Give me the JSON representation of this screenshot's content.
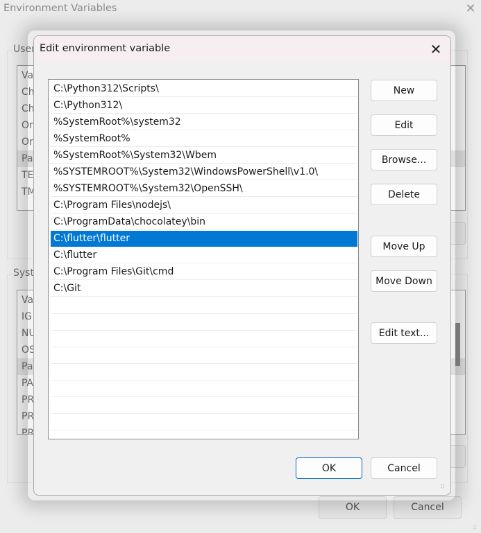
{
  "background_window": {
    "title": "Environment Variables",
    "close_icon": "close-icon",
    "user_group": {
      "label": "User",
      "rows": [
        "Va",
        "Ch",
        "Ch",
        "Or",
        "Or",
        "Pa",
        "TE",
        "TM"
      ],
      "selected_index": 5
    },
    "system_group": {
      "label": "Syste",
      "rows": [
        "Va",
        "IG",
        "NU",
        "OS",
        "Pa",
        "PA",
        "PR",
        "PR",
        "PR"
      ],
      "selected_index": 4
    },
    "buttons": {
      "ok": "OK",
      "cancel": "Cancel"
    }
  },
  "dialog": {
    "title": "Edit environment variable",
    "close_icon": "close-icon",
    "paths": [
      "C:\\Python312\\Scripts\\",
      "C:\\Python312\\",
      "%SystemRoot%\\system32",
      "%SystemRoot%",
      "%SystemRoot%\\System32\\Wbem",
      "%SYSTEMROOT%\\System32\\WindowsPowerShell\\v1.0\\",
      "%SYSTEMROOT%\\System32\\OpenSSH\\",
      "C:\\Program Files\\nodejs\\",
      "C:\\ProgramData\\chocolatey\\bin",
      "C:\\flutter\\flutter",
      "C:\\flutter",
      "C:\\Program Files\\Git\\cmd",
      "C:\\Git"
    ],
    "selected_index": 9,
    "buttons": {
      "new": "New",
      "edit": "Edit",
      "browse": "Browse...",
      "delete": "Delete",
      "move_up": "Move Up",
      "move_down": "Move Down",
      "edit_text": "Edit text...",
      "ok": "OK",
      "cancel": "Cancel"
    },
    "colors": {
      "selection": "#0078d4",
      "title_bar": "#f7eef2",
      "primary_border": "#0067c0"
    }
  }
}
